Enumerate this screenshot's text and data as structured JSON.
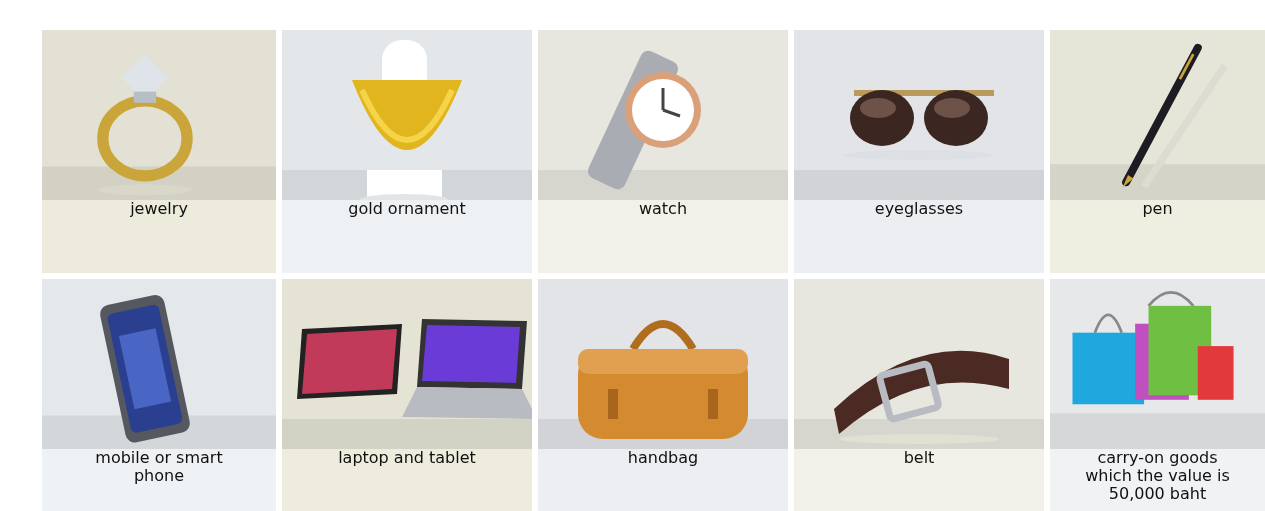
{
  "items": [
    {
      "label": "jewelry"
    },
    {
      "label": "gold ornament"
    },
    {
      "label": "watch"
    },
    {
      "label": "eyeglasses"
    },
    {
      "label": "pen"
    },
    {
      "label": "mobile or smart phone"
    },
    {
      "label": "laptop and tablet"
    },
    {
      "label": "handbag"
    },
    {
      "label": "belt"
    },
    {
      "label": "carry-on goods which the value is 50,000 baht"
    }
  ]
}
